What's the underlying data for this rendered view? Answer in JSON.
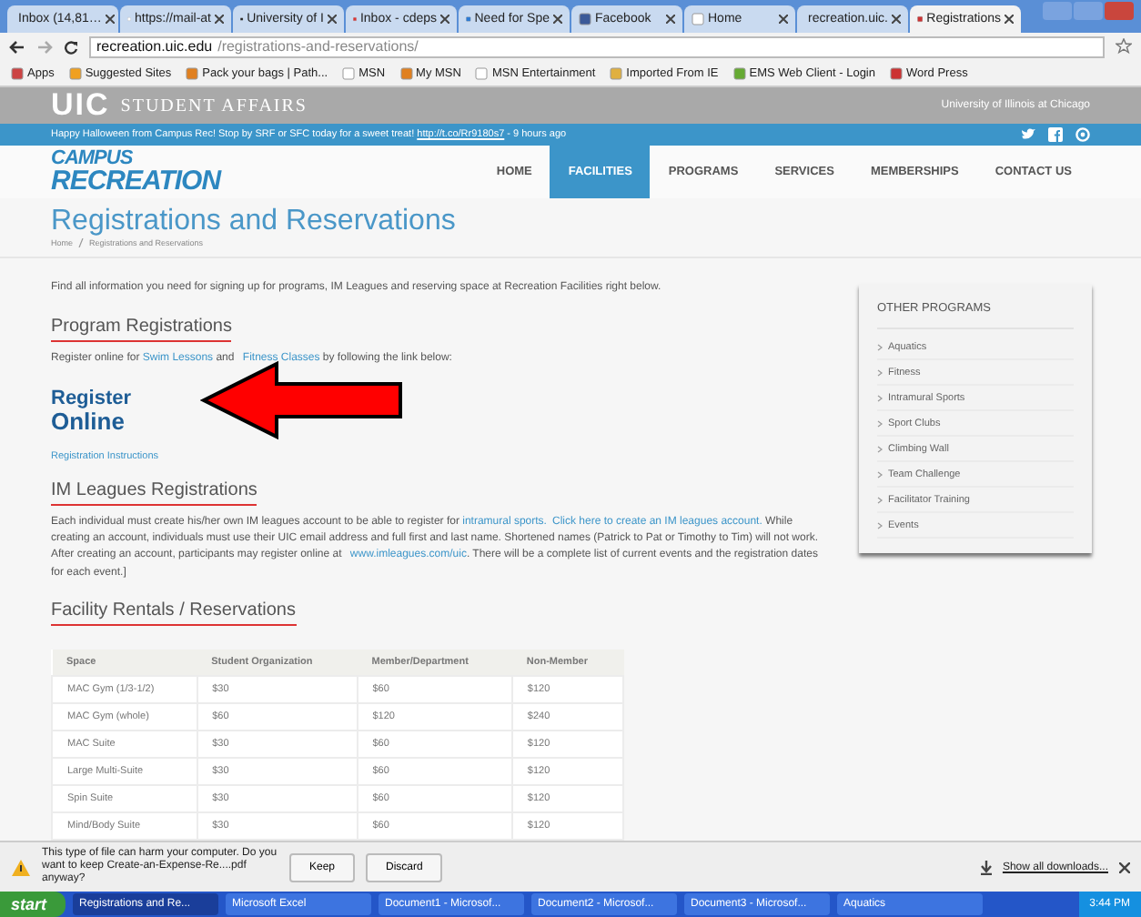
{
  "browser": {
    "tabs": [
      {
        "label": "Inbox (14,81…",
        "kind": "mail",
        "selected": false
      },
      {
        "label": "https://mail-at",
        "kind": "page",
        "selected": false
      },
      {
        "label": "University of I",
        "kind": "uic",
        "selected": false
      },
      {
        "label": "Inbox - cdeps",
        "kind": "mail",
        "selected": false
      },
      {
        "label": "Need for Spe",
        "kind": "game",
        "selected": false
      },
      {
        "label": "Facebook",
        "kind": "facebook",
        "selected": false
      },
      {
        "label": "Home",
        "kind": "page",
        "selected": false
      },
      {
        "label": "recreation.uic.",
        "kind": "rec",
        "selected": false
      },
      {
        "label": "Registrations",
        "kind": "rec",
        "selected": true
      }
    ],
    "address": {
      "host": "recreation.uic.edu",
      "path": "/registrations-and-reservations/"
    },
    "bookmarks": [
      {
        "label": "Apps",
        "kind": "apps"
      },
      {
        "label": "Suggested Sites",
        "kind": "star"
      },
      {
        "label": "Pack your bags | Path...",
        "kind": "person"
      },
      {
        "label": "MSN",
        "kind": "page"
      },
      {
        "label": "My MSN",
        "kind": "person"
      },
      {
        "label": "MSN Entertainment",
        "kind": "page"
      },
      {
        "label": "Imported From IE",
        "kind": "folder"
      },
      {
        "label": "EMS Web Client - Login",
        "kind": "app"
      },
      {
        "label": "Word Press",
        "kind": "rec"
      }
    ]
  },
  "site": {
    "brand": {
      "mark": "UIC",
      "name": "STUDENT AFFAIRS",
      "university": "University of Illinois at Chicago"
    },
    "announcement": {
      "text": "Happy Halloween from Campus Rec! Stop by SRF or SFC today for a sweet treat! ",
      "link": "http://t.co/Rr9180s7",
      "time": " - 9 hours ago"
    },
    "logo": [
      "CAMPUS",
      "RECREATION"
    ],
    "nav": [
      {
        "label": "HOME",
        "selected": false
      },
      {
        "label": "FACILITIES",
        "selected": true
      },
      {
        "label": "PROGRAMS",
        "selected": false
      },
      {
        "label": "SERVICES",
        "selected": false
      },
      {
        "label": "MEMBERSHIPS",
        "selected": false
      },
      {
        "label": "CONTACT US",
        "selected": false
      }
    ],
    "title": "Registrations and Reservations",
    "breadcrumb": [
      "Home",
      "Registrations and Reservations"
    ],
    "intro": "Find all information you need for signing up for programs, IM Leagues and reserving space at Recreation Facilities right below.",
    "program": {
      "heading": "Program Registrations",
      "text": [
        {
          "text": "Register online for ",
          "kind": "text"
        },
        {
          "text": "Swim Lessons",
          "kind": "link"
        },
        {
          "text": " and ",
          "kind": "text"
        },
        {
          "text": "Fitness Classes",
          "kind": "link"
        },
        {
          "text": " by following the link below:",
          "kind": "text"
        }
      ],
      "button": [
        "Register",
        "Online"
      ],
      "instructions": "Registration Instructions"
    },
    "im": {
      "heading": "IM Leagues Registrations",
      "text": [
        {
          "text": "Each individual must create his/her own IM leagues account to be able to register for ",
          "kind": "text"
        },
        {
          "text": "intramural sports.",
          "kind": "link"
        },
        {
          "text": "Click here to create an IM leagues account.",
          "kind": "link"
        },
        {
          "text": " While creating an account, individuals must use their UIC email address and full first and last name. Shortened names (Patrick to Pat or Timothy to Tim) will not work. After creating an account, participants may register online at ",
          "kind": "text"
        },
        {
          "text": "www.imleagues.com/uic",
          "kind": "link"
        },
        {
          "text": ". There will be a complete list of current events and the registration dates for each event.]",
          "kind": "text"
        }
      ]
    },
    "facility": {
      "heading": "Facility Rentals / Reservations",
      "columns": [
        "Space",
        "Student Organization",
        "Member/Department",
        "Non-Member"
      ],
      "rows": [
        [
          "MAC Gym (1/3-1/2)",
          "$30",
          "$60",
          "$120"
        ],
        [
          "MAC Gym (whole)",
          "$60",
          "$120",
          "$240"
        ],
        [
          "MAC Suite",
          "$30",
          "$60",
          "$120"
        ],
        [
          "Large Multi-Suite",
          "$30",
          "$60",
          "$120"
        ],
        [
          "Spin Suite",
          "$30",
          "$60",
          "$120"
        ],
        [
          "Mind/Body Suite",
          "$30",
          "$60",
          "$120"
        ]
      ]
    },
    "sidebar": {
      "title": "OTHER PROGRAMS",
      "items": [
        "Aquatics",
        "Fitness",
        "Intramural Sports",
        "Sport Clubs",
        "Climbing Wall",
        "Team Challenge",
        "Facilitator Training",
        "Events"
      ]
    }
  },
  "download_bar": {
    "message": "This type of file can harm your computer. Do you want to keep Create-an-Expense-Re....pdf anyway?",
    "buttons": [
      "Keep",
      "Discard"
    ],
    "show_all": "Show all downloads..."
  },
  "taskbar": {
    "start": "start",
    "items": [
      {
        "label": "Registrations and Re...",
        "selected": true
      },
      {
        "label": "Microsoft Excel",
        "selected": false
      },
      {
        "label": "Document1 - Microsof...",
        "selected": false
      },
      {
        "label": "Document2 - Microsof...",
        "selected": false
      },
      {
        "label": "Document3 - Microsof...",
        "selected": false
      },
      {
        "label": "Aquatics",
        "selected": false
      }
    ],
    "clock": "3:44 PM"
  }
}
